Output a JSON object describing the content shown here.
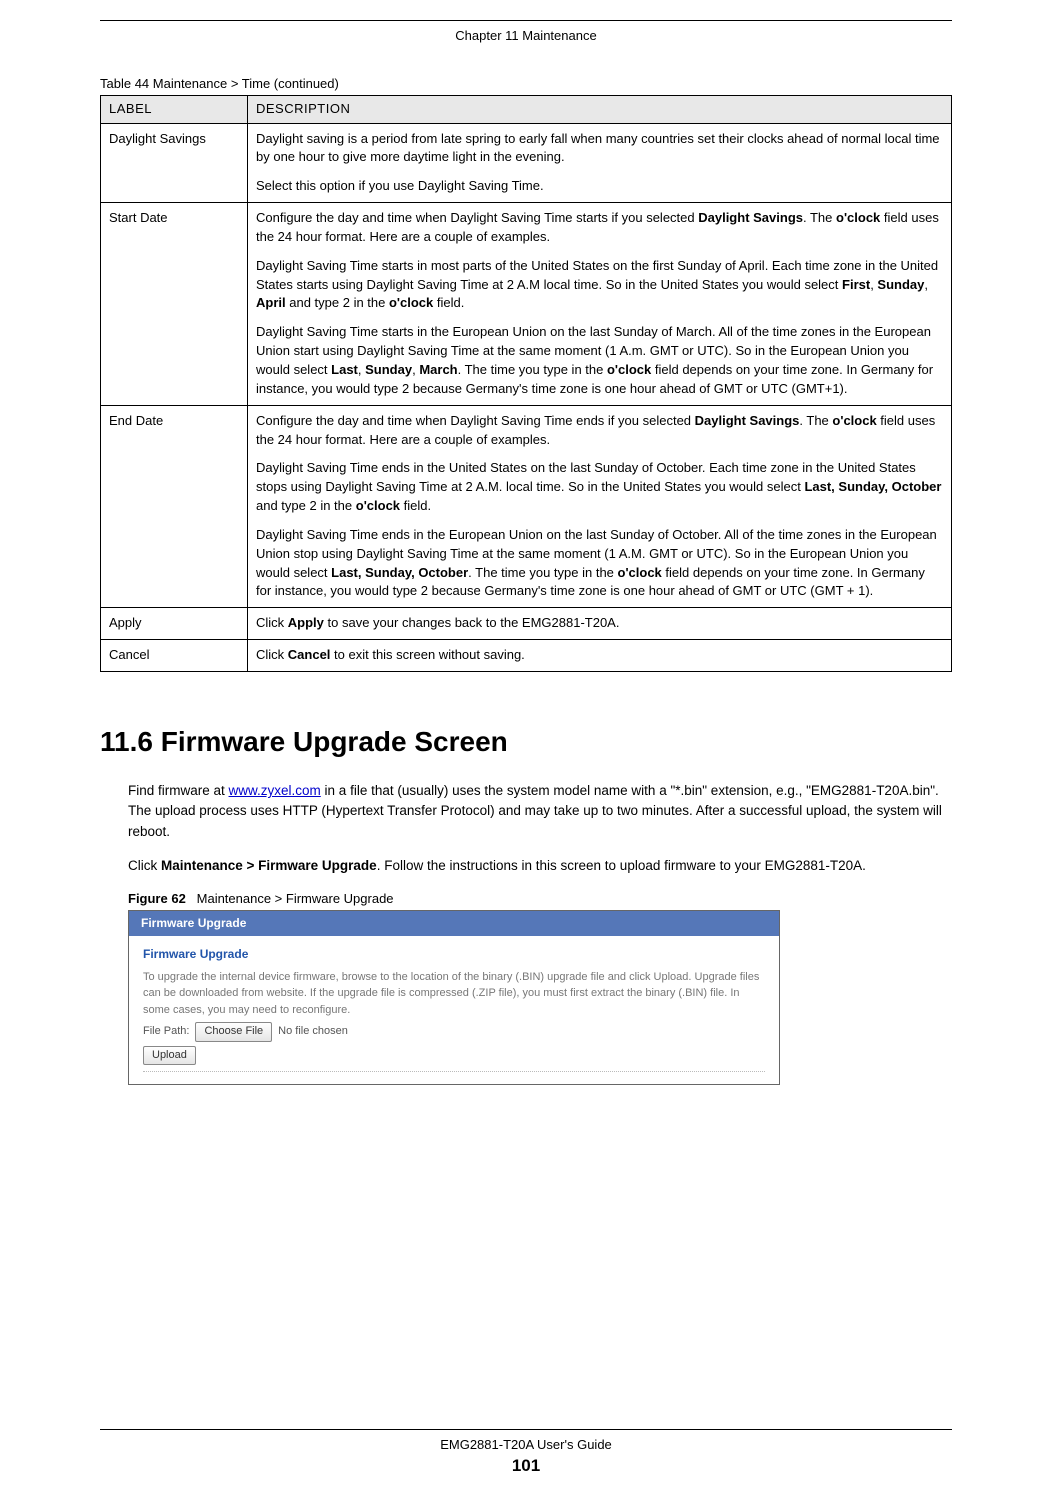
{
  "header": {
    "chapter": "Chapter 11 Maintenance"
  },
  "table": {
    "caption": "Table 44   Maintenance > Time (continued)",
    "headers": {
      "label": "LABEL",
      "desc": "DESCRIPTION"
    },
    "rows": {
      "daylight": {
        "label": "Daylight Savings",
        "p1": "Daylight saving is a period from late spring to early fall when many countries set their clocks ahead of normal local time by one hour to give more daytime light in the evening.",
        "p2": "Select this option if you use Daylight Saving Time."
      },
      "start": {
        "label": "Start Date",
        "p1a": "Configure the day and time when Daylight Saving Time starts if you selected ",
        "p1b": "Daylight Savings",
        "p1c": ". The ",
        "p1d": "o'clock",
        "p1e": " field uses the 24 hour format. Here are a couple of examples.",
        "p2a": "Daylight Saving Time starts in most parts of the United States on the first Sunday of April. Each time zone in the United States starts using Daylight Saving Time at 2 A.M local time. So in the United States you would select ",
        "p2b": "First",
        "p2c": ", ",
        "p2d": "Sunday",
        "p2e": ", ",
        "p2f": "April",
        "p2g": " and type 2 in the ",
        "p2h": "o'clock",
        "p2i": " field.",
        "p3a": "Daylight Saving Time starts in the European Union on the last Sunday of March. All of the time zones in the European Union start using Daylight Saving Time at the same moment (1 A.m. GMT or UTC). So in the European Union you would select ",
        "p3b": "Last",
        "p3c": ", ",
        "p3d": "Sunday",
        "p3e": ", ",
        "p3f": "March",
        "p3g": ". The time you type in the ",
        "p3h": "o'clock",
        "p3i": " field depends on your time zone. In Germany for instance, you would type 2 because Germany's time zone is one hour ahead of GMT or UTC (GMT+1)."
      },
      "end": {
        "label": "End Date",
        "p1a": "Configure the day and time when Daylight Saving Time ends if you selected ",
        "p1b": "Daylight Savings",
        "p1c": ". The ",
        "p1d": "o'clock",
        "p1e": " field uses the 24 hour format. Here are a couple of examples.",
        "p2a": "Daylight Saving Time ends in the United States on the last Sunday of October. Each time zone in the United States stops using Daylight Saving Time at 2 A.M. local time. So in the United States you would select ",
        "p2b": "Last, Sunday, October",
        "p2c": " and type 2 in the ",
        "p2d": "o'clock",
        "p2e": " field.",
        "p3a": "Daylight Saving Time ends in the European Union on the last Sunday of October. All of the time zones in the European Union stop using Daylight Saving Time at the same moment (1 A.M. GMT or UTC). So in the European Union you would select ",
        "p3b": "Last, Sunday, October",
        "p3c": ". The time you type in the ",
        "p3d": "o'clock",
        "p3e": " field depends on your time zone. In Germany for instance, you would type 2 because Germany's time zone is one hour ahead of GMT or UTC (GMT + 1)."
      },
      "apply": {
        "label": "Apply",
        "d1": "Click ",
        "d2": "Apply",
        "d3": " to save your changes back to the EMG2881-T20A."
      },
      "cancel": {
        "label": "Cancel",
        "d1": "Click ",
        "d2": "Cancel",
        "d3": " to exit this screen without saving."
      }
    }
  },
  "section": {
    "title": "11.6  Firmware Upgrade Screen",
    "p1a": "Find firmware at ",
    "p1b": "www.zyxel.com",
    "p1c": " in a file that (usually) uses the system model name with a \"*.bin\" extension, e.g., \"EMG2881-T20A.bin\". The upload process uses HTTP (Hypertext Transfer Protocol) and may take up to two minutes. After a successful upload, the system will reboot.",
    "p2a": "Click ",
    "p2b": "Maintenance > Firmware Upgrade",
    "p2c": ". Follow the instructions in this screen to upload firmware to your EMG2881-T20A."
  },
  "figure": {
    "caption": "Figure 62   Maintenance > Firmware Upgrade",
    "header": "Firmware Upgrade",
    "subtitle": "Firmware Upgrade",
    "text": "To upgrade the internal device firmware, browse to the location of the binary (.BIN) upgrade file and click Upload. Upgrade files can be downloaded from website. If the upgrade file is compressed (.ZIP file), you must first extract the binary (.BIN) file. In some cases, you may need to reconfigure.",
    "filepath_label": "File Path:",
    "choose": "Choose File",
    "nofile": "No file chosen",
    "upload": "Upload"
  },
  "footer": {
    "guide": "EMG2881-T20A User's Guide",
    "page": "101"
  }
}
